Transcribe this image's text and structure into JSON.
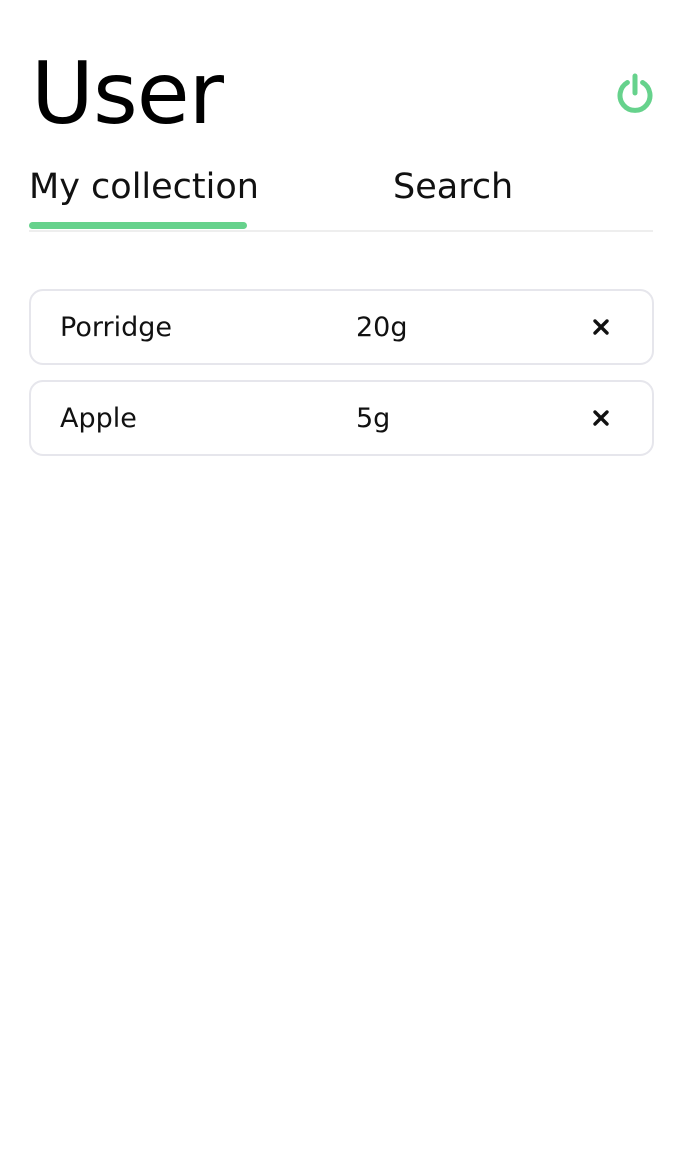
{
  "header": {
    "title": "User",
    "logout_icon": "power-icon",
    "accent_color": "#66d28c"
  },
  "tabs": [
    {
      "label": "My collection",
      "active": true
    },
    {
      "label": "Search",
      "active": false
    }
  ],
  "collection": {
    "items": [
      {
        "name": "Porridge",
        "amount": "20g",
        "remove_icon": "close-icon"
      },
      {
        "name": "Apple",
        "amount": "5g",
        "remove_icon": "close-icon"
      }
    ]
  }
}
